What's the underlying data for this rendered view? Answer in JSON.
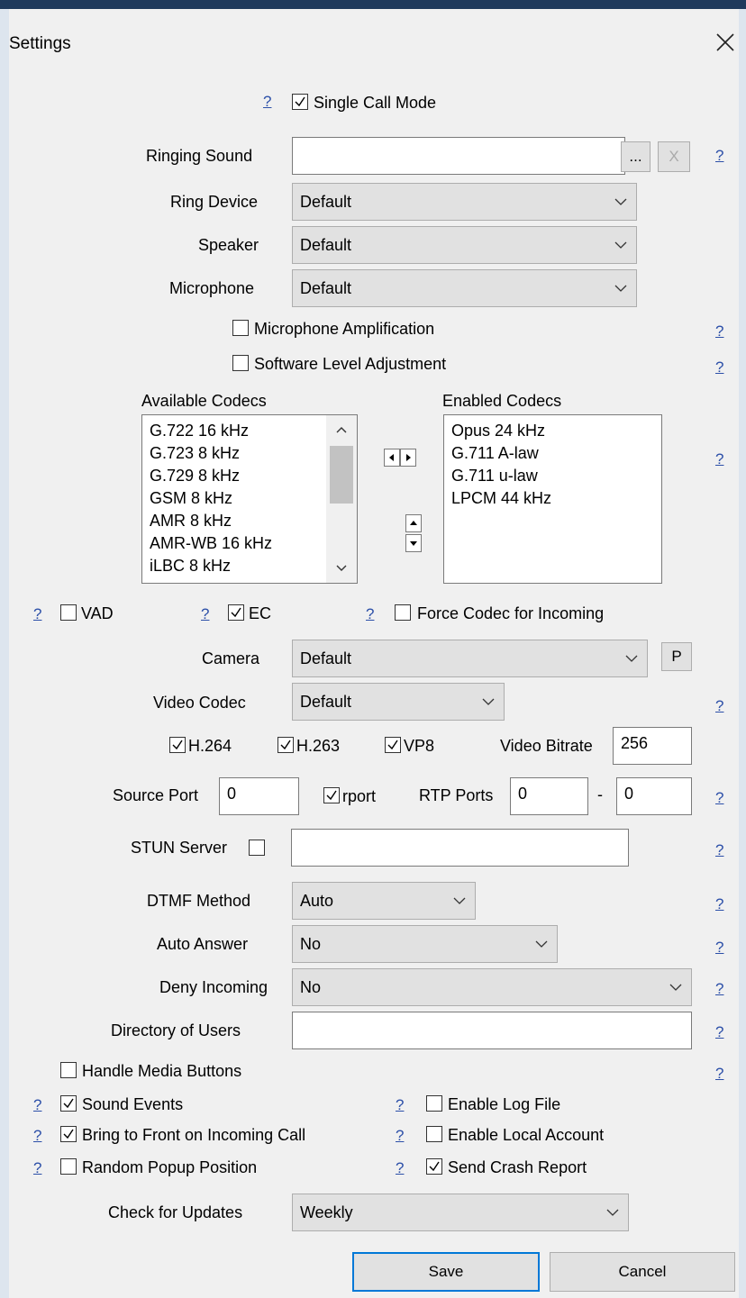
{
  "window": {
    "title": "Settings"
  },
  "help_label": "?",
  "single_call_mode": {
    "label": "Single Call Mode",
    "checked": true
  },
  "ringing_sound": {
    "label": "Ringing Sound",
    "value": "",
    "browse": "...",
    "clear": "X"
  },
  "ring_device": {
    "label": "Ring Device",
    "value": "Default"
  },
  "speaker": {
    "label": "Speaker",
    "value": "Default"
  },
  "microphone": {
    "label": "Microphone",
    "value": "Default"
  },
  "mic_amplification": {
    "label": "Microphone Amplification",
    "checked": false
  },
  "software_level": {
    "label": "Software Level Adjustment",
    "checked": false
  },
  "codecs": {
    "available_label": "Available Codecs",
    "enabled_label": "Enabled Codecs",
    "available": [
      "G.722 16 kHz",
      "G.723 8 kHz",
      "G.729 8 kHz",
      "GSM 8 kHz",
      "AMR 8 kHz",
      "AMR-WB 16 kHz",
      "iLBC 8 kHz"
    ],
    "enabled": [
      "Opus 24 kHz",
      "G.711 A-law",
      "G.711 u-law",
      "LPCM 44 kHz"
    ]
  },
  "vad": {
    "label": "VAD",
    "checked": false
  },
  "ec": {
    "label": "EC",
    "checked": true
  },
  "force_codec": {
    "label": "Force Codec for Incoming",
    "checked": false
  },
  "camera": {
    "label": "Camera",
    "value": "Default",
    "button": "P"
  },
  "video_codec": {
    "label": "Video Codec",
    "value": "Default"
  },
  "h264": {
    "label": "H.264",
    "checked": true
  },
  "h263": {
    "label": "H.263",
    "checked": true
  },
  "vp8": {
    "label": "VP8",
    "checked": true
  },
  "video_bitrate": {
    "label": "Video Bitrate",
    "value": "256"
  },
  "source_port": {
    "label": "Source Port",
    "value": "0"
  },
  "rport": {
    "label": "rport",
    "checked": true
  },
  "rtp_ports": {
    "label": "RTP Ports",
    "from": "0",
    "separator": "-",
    "to": "0"
  },
  "stun": {
    "label": "STUN Server",
    "checked": false,
    "value": ""
  },
  "dtmf": {
    "label": "DTMF Method",
    "value": "Auto"
  },
  "auto_answer": {
    "label": "Auto Answer",
    "value": "No"
  },
  "deny_incoming": {
    "label": "Deny Incoming",
    "value": "No"
  },
  "directory": {
    "label": "Directory of Users",
    "value": ""
  },
  "handle_media": {
    "label": "Handle Media Buttons",
    "checked": false
  },
  "sound_events": {
    "label": "Sound Events",
    "checked": true
  },
  "bring_front": {
    "label": "Bring to Front on Incoming Call",
    "checked": true
  },
  "random_popup": {
    "label": "Random Popup Position",
    "checked": false
  },
  "enable_log": {
    "label": "Enable Log File",
    "checked": false
  },
  "enable_local": {
    "label": "Enable Local Account",
    "checked": false
  },
  "crash_report": {
    "label": "Send Crash Report",
    "checked": true
  },
  "updates": {
    "label": "Check for Updates",
    "value": "Weekly"
  },
  "buttons": {
    "save": "Save",
    "cancel": "Cancel"
  },
  "colors": {
    "accent_bar": "#1f3a5c",
    "help_link": "#2c4fa8",
    "dialog_bg": "#f0f0f0",
    "default_button_border": "#0078d7"
  }
}
